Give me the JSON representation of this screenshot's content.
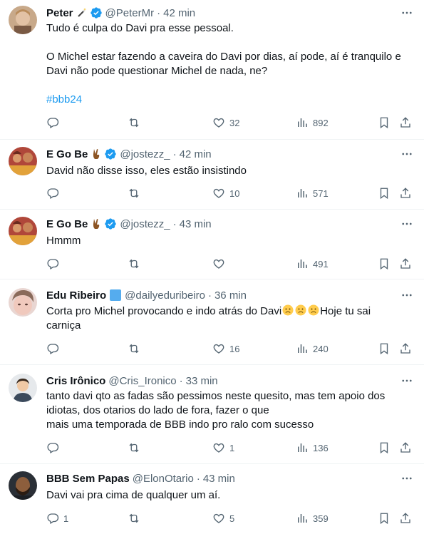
{
  "tweets": [
    {
      "name": "Peter",
      "name_emoji": "magic-wand",
      "verified": true,
      "handle": "@PeterMr",
      "dot": "·",
      "time": "42 min",
      "lines": [
        "Tudo é culpa do Davi pra esse pessoal.",
        "",
        "O Michel estar fazendo a caveira do Davi por dias, aí pode, aí é tranquilo e",
        "Davi não pode questionar Michel de nada, ne?",
        ""
      ],
      "hashtag": "#bbb24",
      "replies": "",
      "retweets": "",
      "likes": "32",
      "views": "892"
    },
    {
      "name": "E Go Be",
      "name_emoji": "victory-hand",
      "verified": true,
      "handle": "@jostezz_",
      "dot": "·",
      "time": "42 min",
      "lines": [
        "David não disse isso, eles estão insistindo"
      ],
      "replies": "",
      "retweets": "",
      "likes": "10",
      "views": "571"
    },
    {
      "name": "E Go Be",
      "name_emoji": "victory-hand",
      "verified": true,
      "handle": "@jostezz_",
      "dot": "·",
      "time": "43 min",
      "lines": [
        "Hmmm"
      ],
      "replies": "",
      "retweets": "",
      "likes": "",
      "views": "491"
    },
    {
      "name": "Edu Ribeiro",
      "name_emoji": "blue-square",
      "verified": false,
      "handle": "@dailyeduribeiro",
      "dot": "·",
      "time": "36 min",
      "line1_before": "Corta pro Michel provocando e indo atrás do Davi",
      "line1_emojis": "sad-face x3",
      "line1_after": "Hoje tu sai",
      "line2": "carniça",
      "replies": "",
      "retweets": "",
      "likes": "16",
      "views": "240"
    },
    {
      "name": "Cris Irônico",
      "name_emoji": "",
      "verified": false,
      "handle": "@Cris_Ironico",
      "dot": "·",
      "time": "33 min",
      "lines": [
        "tanto davi qto as fadas são pessimos neste quesito, mas tem apoio dos",
        "idiotas, dos otarios do lado de fora, fazer o que",
        "mais uma temporada de BBB indo pro ralo com sucesso"
      ],
      "replies": "",
      "retweets": "",
      "likes": "1",
      "views": "136"
    },
    {
      "name": "BBB Sem Papas",
      "name_emoji": "",
      "verified": false,
      "handle": "@ElonOtario",
      "dot": "·",
      "time": "43 min",
      "lines": [
        "Davi vai pra cima de qualquer um aí."
      ],
      "replies": "1",
      "retweets": "",
      "likes": "5",
      "views": "359"
    }
  ],
  "colors": {
    "text": "#0f1419",
    "secondary": "#536471",
    "accent": "#1d9bf0",
    "divider": "#eff3f4"
  },
  "icons": [
    "reply-icon",
    "retweet-icon",
    "like-icon",
    "views-icon",
    "bookmark-icon",
    "share-icon",
    "more-icon",
    "verified-badge-icon"
  ]
}
